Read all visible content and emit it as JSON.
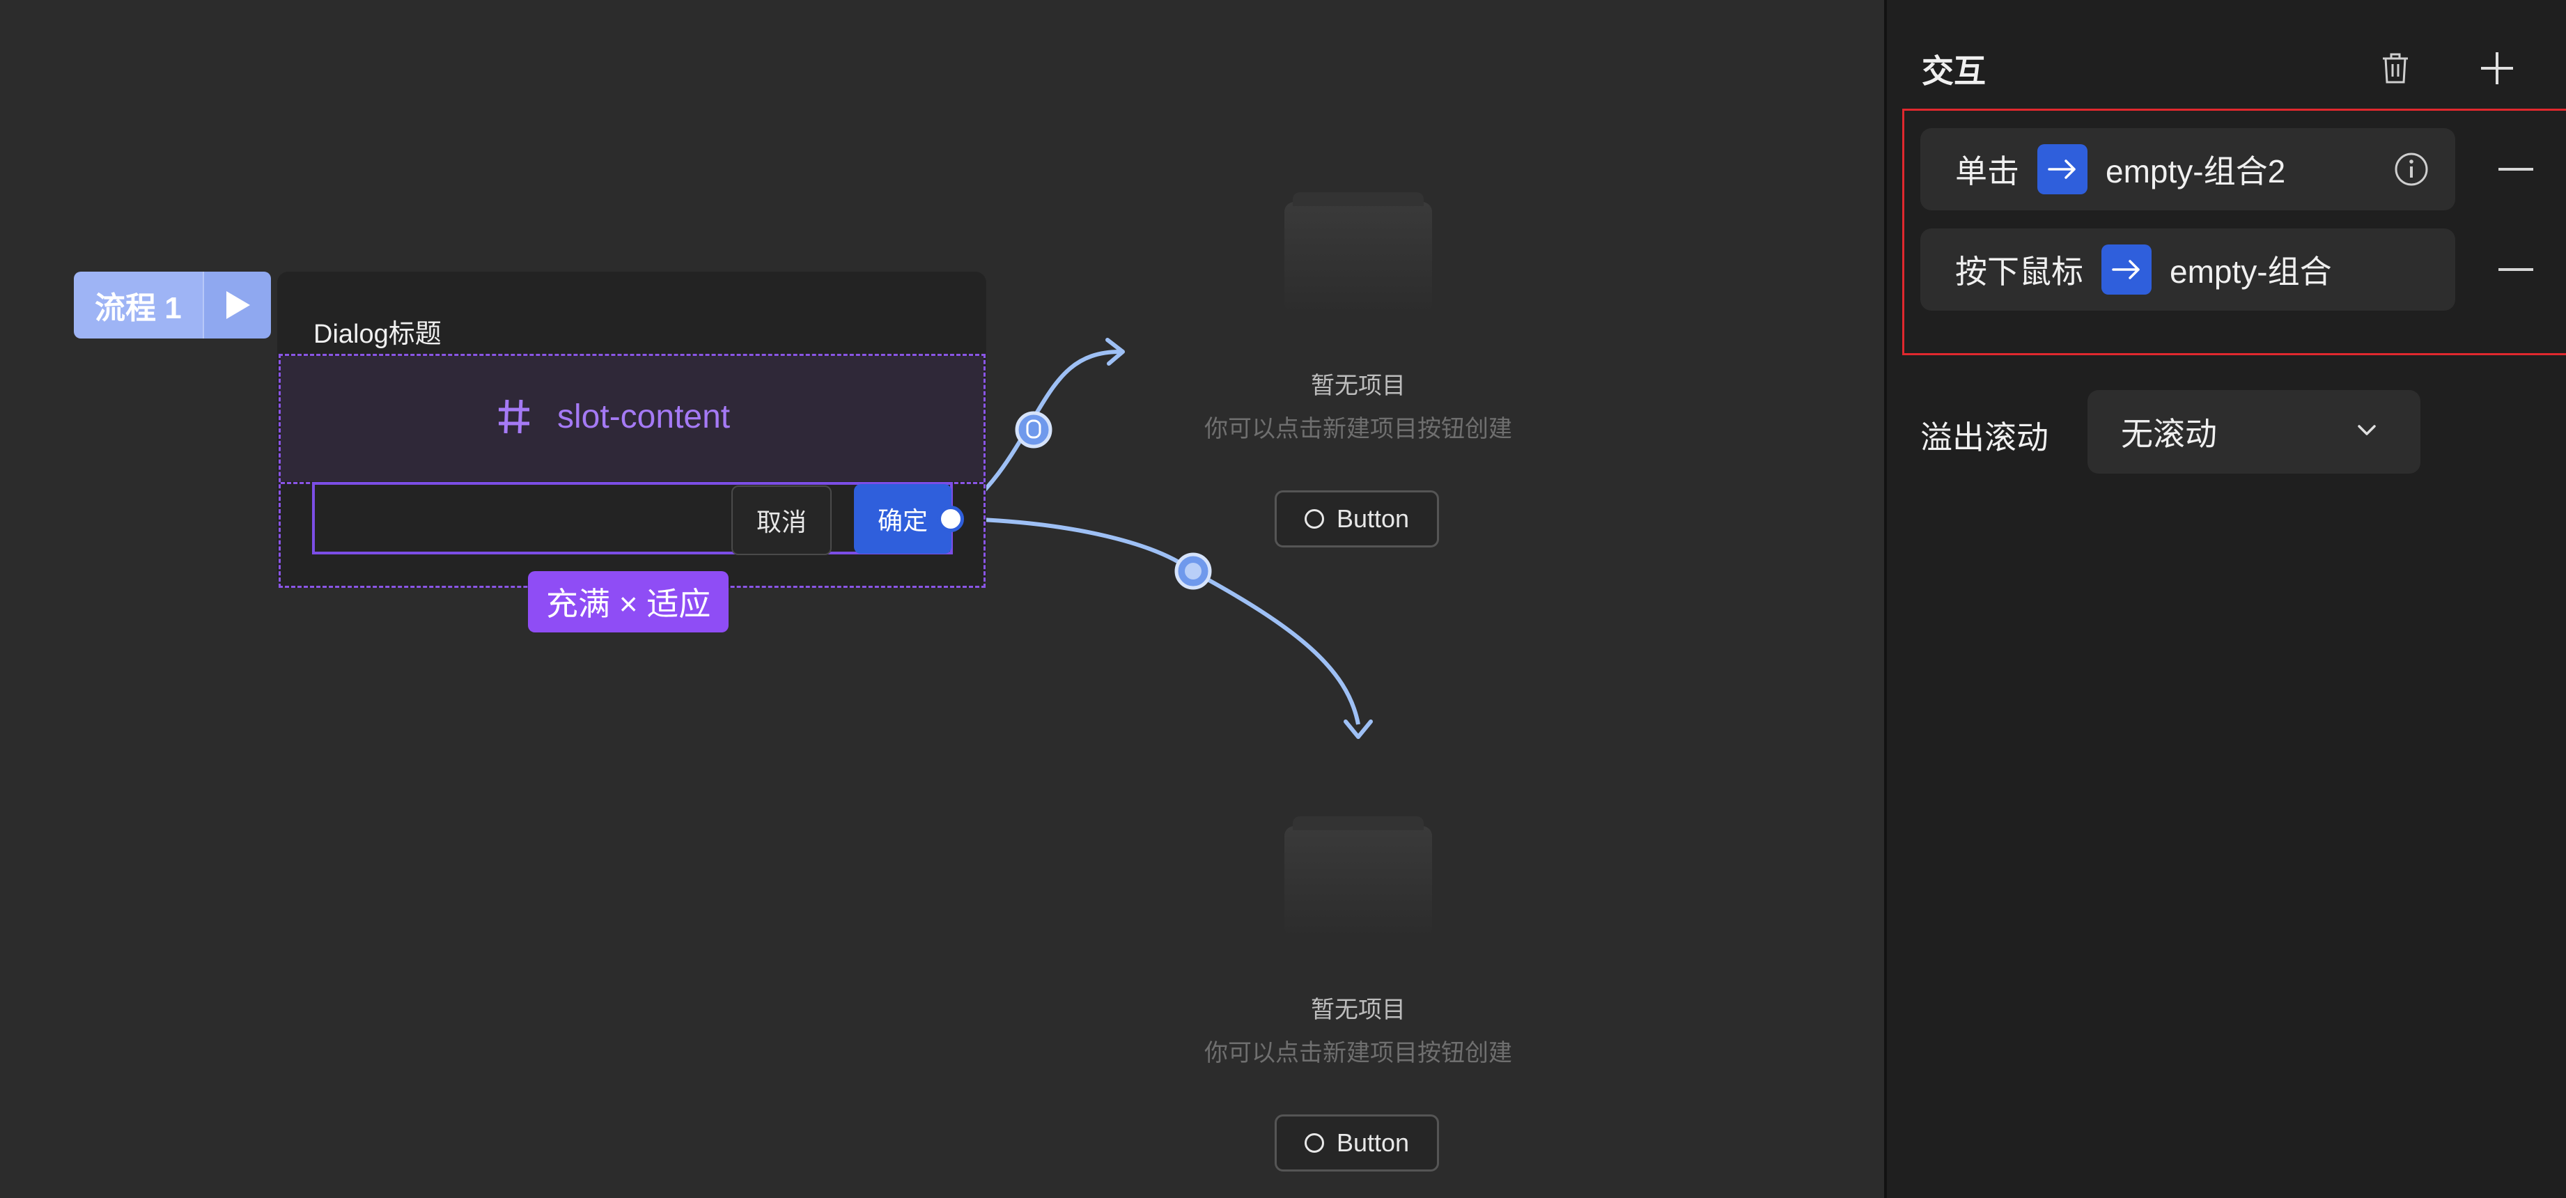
{
  "canvas": {
    "flow": {
      "label": "流程 1",
      "play_icon": "play-icon"
    },
    "dialog": {
      "title": "Dialog标题",
      "slot_label": "slot-content",
      "slot_icon": "hash-icon",
      "cancel_label": "取消",
      "confirm_label": "确定",
      "size_tag": "充满 × 适应"
    },
    "empty_states": [
      {
        "title": "暂无项目",
        "subtitle": "你可以点击新建项目按钮创建",
        "button_label": "Button"
      },
      {
        "title": "暂无项目",
        "subtitle": "你可以点击新建项目按钮创建",
        "button_label": "Button"
      }
    ]
  },
  "panel": {
    "title": "交互",
    "delete_icon": "trash-icon",
    "add_icon": "plus-icon",
    "interactions": [
      {
        "trigger": "单击",
        "target": "empty-组合2",
        "has_info": true
      },
      {
        "trigger": "按下鼠标",
        "target": "empty-组合",
        "has_info": false
      }
    ],
    "overflow": {
      "label": "溢出滚动",
      "value": "无滚动"
    }
  },
  "colors": {
    "canvas_bg": "#2c2c2c",
    "panel_bg": "#1f1f1f",
    "accent_blue": "#2f5fdc",
    "accent_purple": "#8f4df5",
    "connector": "#9ec0f5",
    "highlight_red": "#e0282e"
  }
}
